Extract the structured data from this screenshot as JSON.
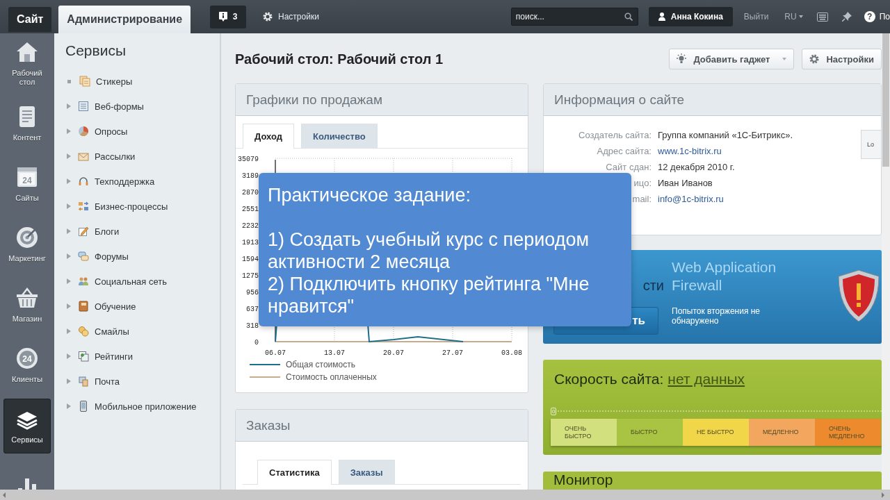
{
  "topbar": {
    "tabs": [
      {
        "label": "Сайт",
        "selected": false
      },
      {
        "label": "Администрирование",
        "selected": true
      }
    ],
    "notifications": "3",
    "settings": "Настройки",
    "search": {
      "placeholder": "поиск..."
    },
    "user": "Анна Кокина",
    "logout": "Выйти",
    "language": "RU",
    "help": {
      "icon": "?",
      "label": "По"
    }
  },
  "nav": [
    {
      "label": "Рабочий стол",
      "selected": false
    },
    {
      "label": "Контент",
      "selected": false
    },
    {
      "label": "Сайты",
      "icon_text": "24",
      "selected": false
    },
    {
      "label": "Маркетинг",
      "selected": false
    },
    {
      "label": "Магазин",
      "selected": false
    },
    {
      "label": "Клиенты",
      "icon_text": "24",
      "selected": false
    },
    {
      "label": "Сервисы",
      "selected": true
    },
    {
      "selected": false
    }
  ],
  "services": {
    "title": "Сервисы",
    "items": [
      {
        "label": "Стикеры",
        "expandable": false
      },
      {
        "label": "Веб-формы",
        "expandable": true
      },
      {
        "label": "Опросы",
        "expandable": true
      },
      {
        "label": "Рассылки",
        "expandable": true
      },
      {
        "label": "Техподдержка",
        "expandable": true
      },
      {
        "label": "Бизнес-процессы",
        "expandable": true
      },
      {
        "label": "Блоги",
        "expandable": true
      },
      {
        "label": "Форумы",
        "expandable": true
      },
      {
        "label": "Социальная сеть",
        "expandable": true
      },
      {
        "label": "Обучение",
        "expandable": true
      },
      {
        "label": "Смайлы",
        "expandable": true
      },
      {
        "label": "Рейтинги",
        "expandable": true
      },
      {
        "label": "Почта",
        "expandable": true
      },
      {
        "label": "Мобильное приложение",
        "expandable": true
      }
    ]
  },
  "page_title": "Рабочий стол: Рабочий стол 1",
  "toolbar": [
    {
      "label": "Добавить гаджет",
      "kind": "dropdown"
    },
    {
      "label": "Настройки",
      "kind": "plain"
    }
  ],
  "sales": {
    "title": "Графики по продажам",
    "tabs": [
      {
        "label": "Доход",
        "selected": true
      },
      {
        "label": "Количество",
        "selected": false
      }
    ],
    "chart": {
      "x_labels": [
        "06.07",
        "13.07",
        "20.07",
        "27.07",
        "03.08"
      ],
      "y_labels": [
        "35079",
        "3189",
        "2870",
        "2551",
        "2232",
        "1913",
        "1594",
        "1275",
        "956",
        "637",
        "318",
        "0"
      ],
      "legend": [
        {
          "name": "Общая стоимость",
          "color": "#1f6f8b"
        },
        {
          "name": "Стоимость оплаченных",
          "color": "#c8ab8c"
        }
      ]
    }
  },
  "orders": {
    "title": "Заказы",
    "tabs": [
      {
        "label": "Статистика",
        "selected": true
      },
      {
        "label": "Заказы",
        "selected": false
      }
    ]
  },
  "site_info": {
    "title": "Информация о сайте",
    "rows": [
      {
        "label": "Создатель сайта:",
        "value": "Группа компаний «1С-Битрикс».",
        "kind": "text"
      },
      {
        "label": "Адрес сайта:",
        "value": "www.1c-bitrix.ru",
        "kind": "link"
      },
      {
        "label": "Сайт сдан:",
        "value": "12 декабря 2010 г.",
        "kind": "text"
      },
      {
        "label": "ицо:",
        "value": "Иван Иванов",
        "kind": "text"
      },
      {
        "label": "mail:",
        "value": "info@1c-bitrix.ru",
        "kind": "link"
      }
    ],
    "button": "Lo"
  },
  "security": {
    "title": "сти",
    "button": "ть",
    "waf_title": "Web Application Firewall",
    "status": "Попыток вторжения не обнаружено"
  },
  "speed": {
    "title": "Скорость сайта:",
    "value": "нет данных",
    "scale_start": "0",
    "segments": [
      {
        "label": "ОЧЕНЬ БЫСТРО",
        "color": "#d3e07e"
      },
      {
        "label": "БЫСТРО",
        "color": "#a9c443"
      },
      {
        "label": "НЕ БЫСТРО",
        "color": "#f2d64a"
      },
      {
        "label": "МЕДЛЕННО",
        "color": "#f3a75e"
      },
      {
        "label": "ОЧЕНЬ МЕДЛЕННО",
        "color": "#ee8a2e"
      }
    ]
  },
  "monitor": {
    "title": "Монитор"
  },
  "overlay": {
    "title": "Практическое задание:",
    "lines": [
      "1) Создать учебный курс с периодом активности 2 месяца",
      "2) Подключить кнопку рейтинга \"Мне нравится\""
    ]
  }
}
